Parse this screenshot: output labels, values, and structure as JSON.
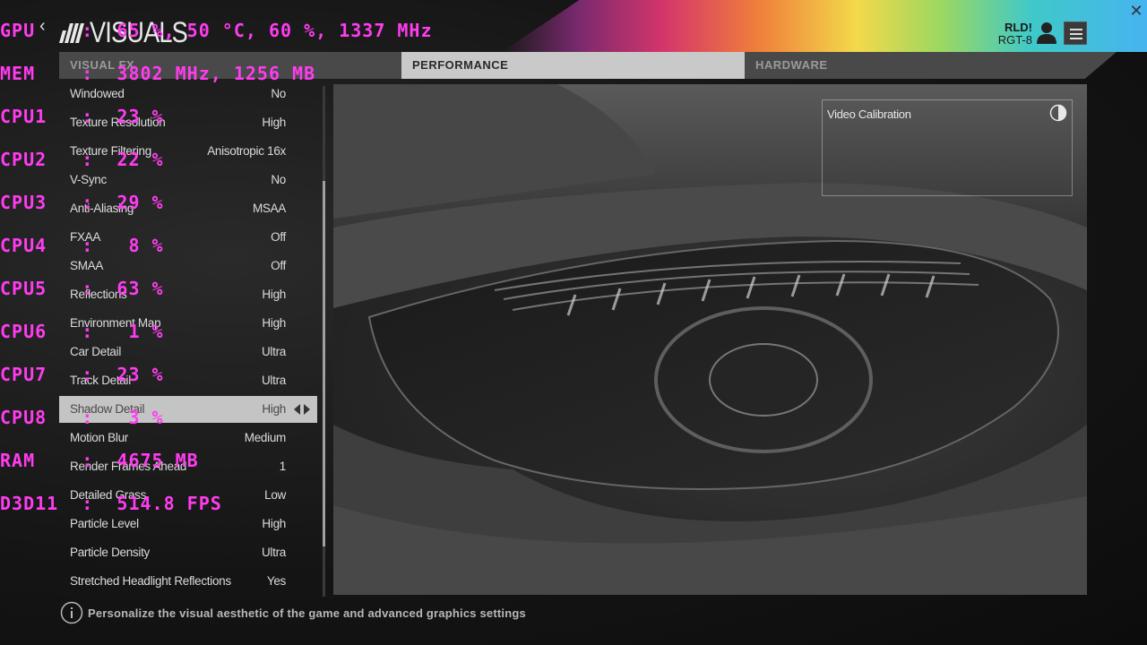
{
  "header": {
    "title": "VISUALS",
    "user_name": "RLD!",
    "user_id": "RGT-8",
    "accent_rainbow": [
      "#7a2a6e",
      "#d4356a",
      "#f0803a",
      "#f3d94a",
      "#9cd860",
      "#3fc9c8",
      "#46b4f0"
    ]
  },
  "tabs": [
    {
      "label": "VISUAL FX",
      "active": false
    },
    {
      "label": "PERFORMANCE",
      "active": true
    },
    {
      "label": "HARDWARE",
      "active": false
    }
  ],
  "settings": [
    {
      "label": "Windowed",
      "value": "No"
    },
    {
      "label": "Texture Resolution",
      "value": "High"
    },
    {
      "label": "Texture Filtering",
      "value": "Anisotropic 16x"
    },
    {
      "label": "V-Sync",
      "value": "No"
    },
    {
      "label": "Anti-Aliasing",
      "value": "MSAA"
    },
    {
      "label": "FXAA",
      "value": "Off"
    },
    {
      "label": "SMAA",
      "value": "Off"
    },
    {
      "label": "Reflections",
      "value": "High"
    },
    {
      "label": "Environment Map",
      "value": "High"
    },
    {
      "label": "Car Detail",
      "value": "Ultra"
    },
    {
      "label": "Track Detail",
      "value": "Ultra"
    },
    {
      "label": "Shadow Detail",
      "value": "High",
      "selected": true
    },
    {
      "label": "Motion Blur",
      "value": "Medium"
    },
    {
      "label": "Render Frames Ahead",
      "value": "1"
    },
    {
      "label": "Detailed Grass",
      "value": "Low"
    },
    {
      "label": "Particle Level",
      "value": "High"
    },
    {
      "label": "Particle Density",
      "value": "Ultra"
    },
    {
      "label": "Stretched Headlight Reflections",
      "value": "Yes"
    }
  ],
  "preview": {
    "calibration_label": "Video Calibration"
  },
  "footer": {
    "hint": "Personalize the visual aesthetic of the game and advanced graphics settings"
  },
  "overlay": {
    "lines": [
      "GPU    :  65 %, 50 °C, 60 %, 1337 MHz",
      "MEM    :  3802 MHz, 1256 MB",
      "CPU1   :  23 %",
      "CPU2   :  22 %",
      "CPU3   :  29 %",
      "CPU4   :   8 %",
      "CPU5   :  63 %",
      "CPU6   :   1 %",
      "CPU7   :  23 %",
      "CPU8   :   3 %",
      "RAM    :  4675 MB",
      "D3D11  :  514.8 FPS"
    ]
  }
}
